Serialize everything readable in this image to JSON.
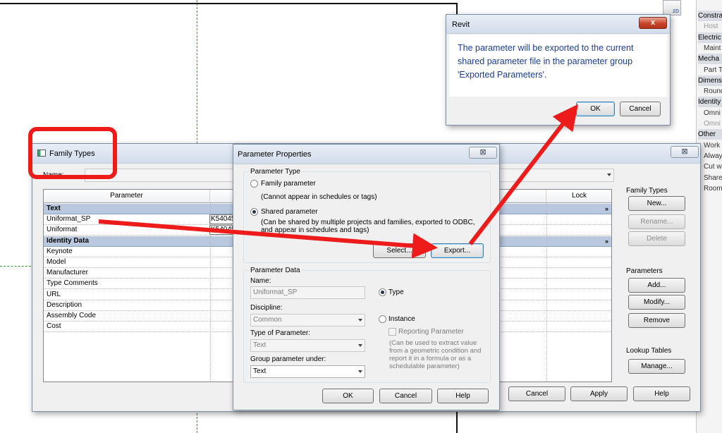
{
  "properties_panel": {
    "rows": [
      {
        "text": "Constra",
        "kind": "head"
      },
      {
        "text": "Host",
        "kind": "grey"
      },
      {
        "text": "Electric",
        "kind": "head"
      },
      {
        "text": "Maint",
        "kind": "sub"
      },
      {
        "text": "Mecha",
        "kind": "head"
      },
      {
        "text": "Part T",
        "kind": "sub"
      },
      {
        "text": "Dimens",
        "kind": "head"
      },
      {
        "text": "Round",
        "kind": "sub"
      },
      {
        "text": "Identity",
        "kind": "head"
      },
      {
        "text": "Omni",
        "kind": "sub"
      },
      {
        "text": "Omni",
        "kind": "grey"
      },
      {
        "text": "Other",
        "kind": "head"
      },
      {
        "text": "Work",
        "kind": "sub"
      },
      {
        "text": "Alway",
        "kind": "sub"
      },
      {
        "text": "Cut w",
        "kind": "sub"
      },
      {
        "text": "Shared",
        "kind": "sub"
      },
      {
        "text": "Room",
        "kind": "sub"
      }
    ],
    "view_icon_label": "2D"
  },
  "revit_dialog": {
    "title": "Revit",
    "close_glyph": "x",
    "message": "The parameter will be exported to the current shared parameter file in the parameter group 'Exported Parameters'.",
    "ok_label": "OK",
    "cancel_label": "Cancel",
    "message_color": "#1b3f8f"
  },
  "family_types": {
    "title": "Family Types",
    "close_glyph": "⊠",
    "name_label": "Name:",
    "columns": [
      "Parameter",
      "Lock"
    ],
    "rows": [
      {
        "label": "Text",
        "section": true,
        "chevron": "»"
      },
      {
        "label": "Uniformat_SP",
        "value": "K54045"
      },
      {
        "label": "Uniformat",
        "value": "K54045"
      },
      {
        "label": "Identity Data",
        "section": true,
        "chevron": "»"
      },
      {
        "label": "Keynote"
      },
      {
        "label": "Model"
      },
      {
        "label": "Manufacturer"
      },
      {
        "label": "Type Comments"
      },
      {
        "label": "URL"
      },
      {
        "label": "Description"
      },
      {
        "label": "Assembly Code"
      },
      {
        "label": "Cost"
      }
    ],
    "family_types_group": "Family Types",
    "new_label": "New...",
    "rename_label": "Rename...",
    "delete_label": "Delete",
    "parameters_group": "Parameters",
    "add_label": "Add...",
    "modify_label": "Modify...",
    "remove_label": "Remove",
    "lookup_group": "Lookup Tables",
    "manage_label": "Manage...",
    "cancel_label": "Cancel",
    "apply_label": "Apply",
    "help_label": "Help"
  },
  "parameter_properties": {
    "title": "Parameter Properties",
    "close_glyph": "⊠",
    "type_group": "Parameter Type",
    "family_param_label": "Family parameter",
    "family_param_note": "(Cannot appear in schedules or tags)",
    "shared_param_label": "Shared parameter",
    "shared_param_note": "(Can be shared by multiple projects and families, exported to ODBC, and appear in schedules and tags)",
    "select_label": "Select...",
    "export_label": "Export...",
    "data_group": "Parameter Data",
    "name_label": "Name:",
    "name_value": "Uniformat_SP",
    "type_radio_label": "Type",
    "discipline_label": "Discipline:",
    "discipline_value": "Common",
    "instance_radio_label": "Instance",
    "reporting_label": "Reporting Parameter",
    "type_of_param_label": "Type of Parameter:",
    "type_of_param_value": "Text",
    "reporting_note": "(Can be used to extract value from a geometric condition and report it in a formula or as a schedulable parameter)",
    "group_under_label": "Group parameter under:",
    "group_under_value": "Text",
    "ok_label": "OK",
    "cancel_label": "Cancel",
    "help_label": "Help"
  },
  "annotations": {
    "color": "#ee1b1b"
  }
}
